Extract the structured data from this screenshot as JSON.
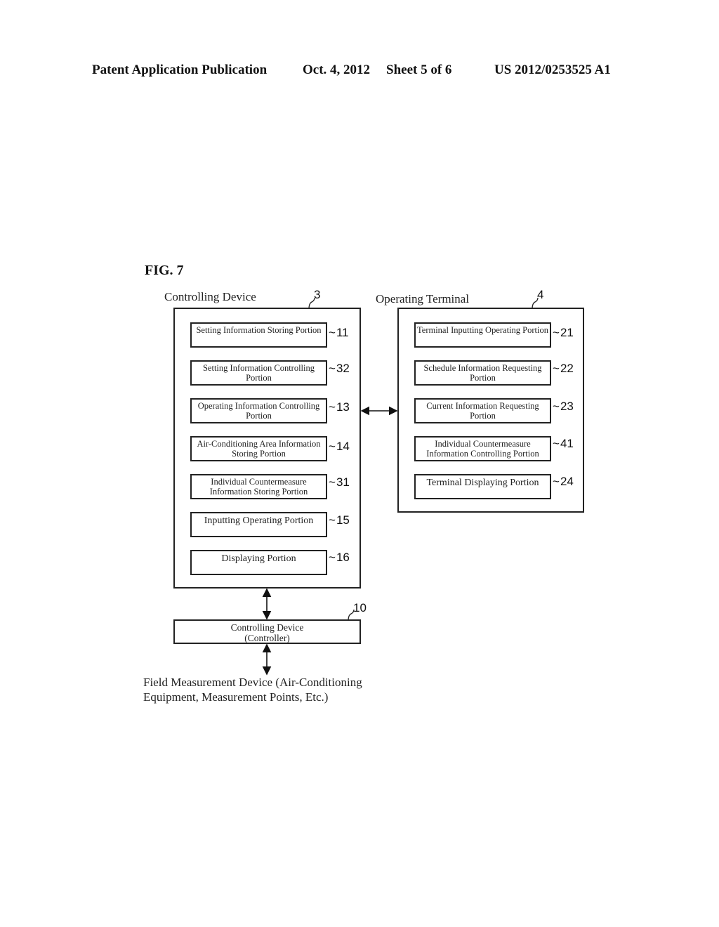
{
  "header": {
    "publication": "Patent Application Publication",
    "date": "Oct. 4, 2012",
    "sheet": "Sheet 5 of 6",
    "number": "US 2012/0253525 A1"
  },
  "figure": {
    "label": "FIG. 7",
    "controlling_device": {
      "title": "Controlling Device",
      "ref": "3",
      "blocks": [
        {
          "label": "Setting Information Storing Portion",
          "ref": "11"
        },
        {
          "label": "Setting Information Controlling Portion",
          "ref": "32"
        },
        {
          "label": "Operating Information Controlling Portion",
          "ref": "13"
        },
        {
          "label": "Air-Conditioning Area Information Storing Portion",
          "ref": "14"
        },
        {
          "label": "Individual Countermeasure Information Storing Portion",
          "ref": "31"
        },
        {
          "label": "Inputting Operating Portion",
          "ref": "15"
        },
        {
          "label": "Displaying Portion",
          "ref": "16"
        }
      ]
    },
    "operating_terminal": {
      "title": "Operating Terminal",
      "ref": "4",
      "blocks": [
        {
          "label": "Terminal Inputting Operating Portion",
          "ref": "21"
        },
        {
          "label": "Schedule Information Requesting Portion",
          "ref": "22"
        },
        {
          "label": "Current Information Requesting Portion",
          "ref": "23"
        },
        {
          "label": "Individual Countermeasure Information Controlling Portion",
          "ref": "41"
        },
        {
          "label": "Terminal Displaying Portion",
          "ref": "24"
        }
      ]
    },
    "controller": {
      "label": "Controlling Device (Controller)",
      "ref": "10"
    },
    "field_device": "Field Measurement Device (Air-Conditioning Equipment, Measurement Points, Etc.)"
  }
}
